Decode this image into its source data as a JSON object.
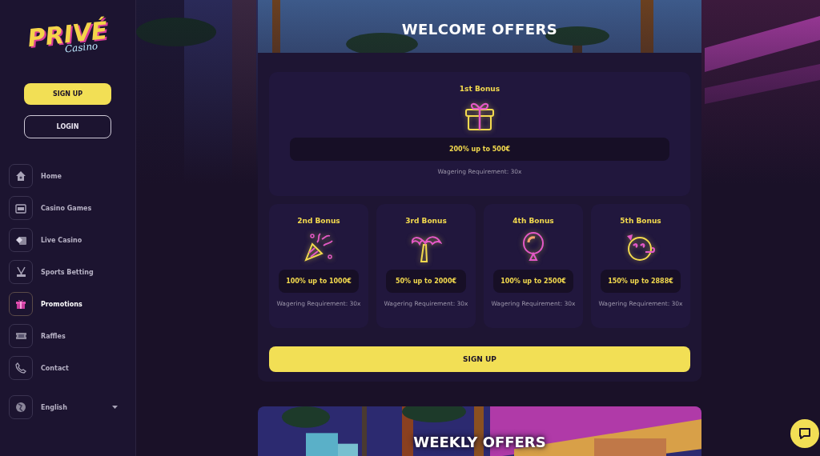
{
  "logo": {
    "title": "PRIVÉ",
    "subtitle": "Casino"
  },
  "auth": {
    "signup": "SIGN UP",
    "login": "LOGIN"
  },
  "nav": [
    {
      "label": "Home",
      "selected": false
    },
    {
      "label": "Casino Games",
      "selected": false
    },
    {
      "label": "Live Casino",
      "selected": false
    },
    {
      "label": "Sports Betting",
      "selected": false
    },
    {
      "label": "Promotions",
      "selected": true
    },
    {
      "label": "Raffles",
      "selected": false
    },
    {
      "label": "Contact",
      "selected": false
    }
  ],
  "language": {
    "label": "English"
  },
  "welcome": {
    "title": "WELCOME OFFERS",
    "bonuses": [
      {
        "title": "1st Bonus",
        "offer": "200% up to 500€",
        "note": "Wagering Requirement: 30x"
      },
      {
        "title": "2nd Bonus",
        "offer": "100% up to 1000€",
        "note": "Wagering Requirement: 30x"
      },
      {
        "title": "3rd Bonus",
        "offer": "50% up to 2000€",
        "note": "Wagering Requirement: 30x"
      },
      {
        "title": "4th Bonus",
        "offer": "100% up to 2500€",
        "note": "Wagering Requirement: 30x"
      },
      {
        "title": "5th Bonus",
        "offer": "150% up to 2888€",
        "note": "Wagering Requirement: 30x"
      }
    ],
    "button": "SIGN UP"
  },
  "weekly": {
    "title": "WEEKLY OFFERS"
  }
}
